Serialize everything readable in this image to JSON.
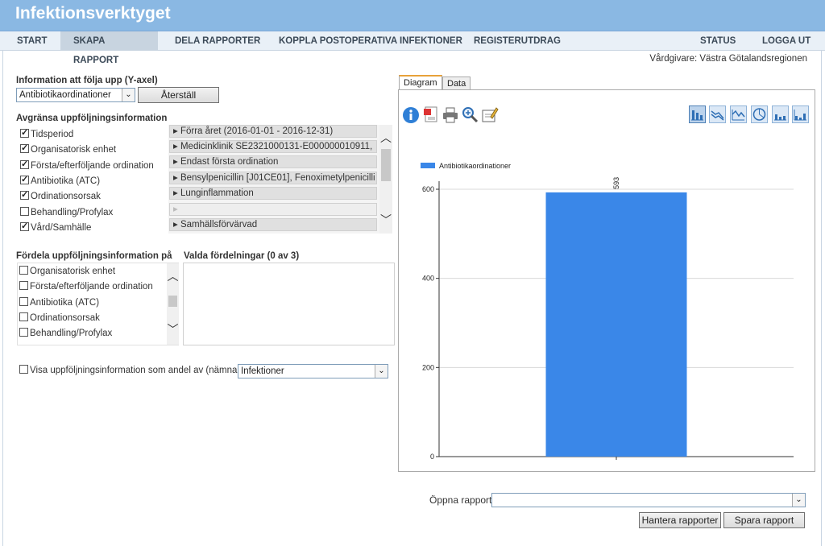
{
  "app": {
    "title": "Infektionsverktyget"
  },
  "nav": {
    "items": [
      "START",
      "SKAPA RAPPORT",
      "DELA RAPPORTER",
      "KOPPLA POSTOPERATIVA INFEKTIONER",
      "REGISTERUTDRAG"
    ],
    "right_items": [
      "STATUS",
      "LOGGA UT"
    ],
    "active": "SKAPA RAPPORT"
  },
  "vardgivare": "Vårdgivare: Västra Götalandsregionen",
  "yaxis": {
    "label": "Information att följa upp (Y-axel)",
    "selected": "Antibiotikaordinationer",
    "reset_button": "Återställ"
  },
  "avgransa": {
    "label": "Avgränsa uppföljningsinformation",
    "items": [
      {
        "label": "Tidsperiod",
        "checked": true,
        "value": "Förra året (2016-01-01 - 2016-12-31)"
      },
      {
        "label": "Organisatorisk enhet",
        "checked": true,
        "value": "Medicinklinik SE2321000131-E000000010911, "
      },
      {
        "label": "Första/efterföljande ordination",
        "checked": true,
        "value": "Endast första ordination"
      },
      {
        "label": "Antibiotika (ATC)",
        "checked": true,
        "value": "Bensylpenicillin [J01CE01], Fenoximetylpenicilli"
      },
      {
        "label": "Ordinationsorsak",
        "checked": true,
        "value": "Lunginflammation"
      },
      {
        "label": "Behandling/Profylax",
        "checked": false,
        "value": ""
      },
      {
        "label": "Vård/Samhälle",
        "checked": true,
        "value": "Samhällsförvärvad"
      }
    ]
  },
  "fordela": {
    "label": "Fördela uppföljningsinformation på",
    "items": [
      {
        "label": "Organisatorisk enhet",
        "checked": false
      },
      {
        "label": "Första/efterföljande ordination",
        "checked": false
      },
      {
        "label": "Antibiotika (ATC)",
        "checked": false
      },
      {
        "label": "Ordinationsorsak",
        "checked": false
      },
      {
        "label": "Behandling/Profylax",
        "checked": false
      }
    ]
  },
  "valda": {
    "label": "Valda fördelningar (0 av 3)"
  },
  "andel": {
    "label": "Visa uppföljningsinformation som andel av (nämnare)",
    "checked": false,
    "selected": "Infektioner"
  },
  "tabs": [
    "Diagram",
    "Data"
  ],
  "active_tab": "Diagram",
  "toolbar_icons": [
    "info-icon",
    "export-pdf-icon",
    "print-icon",
    "zoom-icon",
    "edit-icon"
  ],
  "chart_type_icons": [
    "bar-chart-icon",
    "line-chart-icon",
    "area-chart-icon",
    "pie-chart-icon",
    "column-chart-icon",
    "stacked-chart-icon"
  ],
  "chart_data": {
    "type": "bar",
    "categories": [
      ""
    ],
    "series": [
      {
        "name": "Antibiotikaordinationer",
        "values": [
          593
        ]
      }
    ],
    "data_labels": [
      "593"
    ],
    "yticks": [
      "0",
      "200",
      "400",
      "600"
    ],
    "ylim": [
      0,
      600
    ],
    "grid": true,
    "legend": "top-left",
    "colors": {
      "bar": "#3a87e8"
    }
  },
  "bottom": {
    "open_label": "Öppna rapport",
    "open_selected": "",
    "manage_button": "Hantera rapporter",
    "save_button": "Spara rapport"
  }
}
